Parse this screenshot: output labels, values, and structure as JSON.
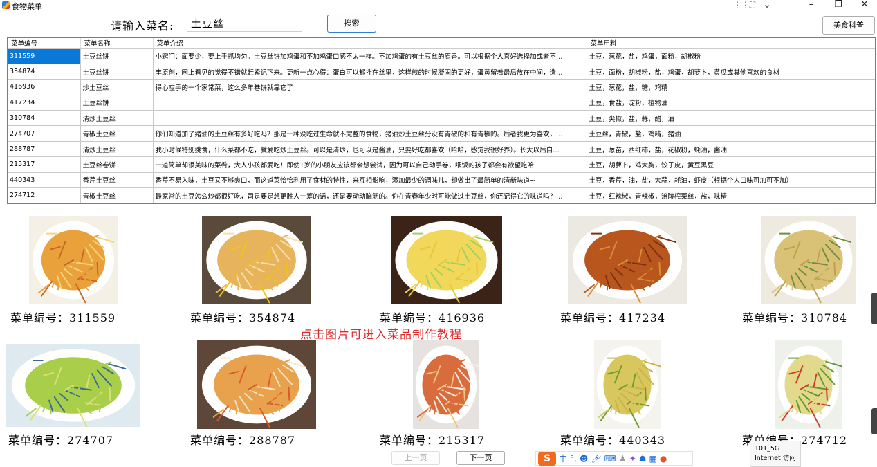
{
  "window": {
    "title": "食物菜单",
    "minimize": "–",
    "maximize": "❐",
    "close": "✕"
  },
  "titlebar_tools": {
    "grip": "⋮⋮",
    "expand": "⛶",
    "chevron": "⌄"
  },
  "search": {
    "label": "请输入菜名:",
    "value": "土豆丝",
    "button": "搜索"
  },
  "cookbook_button": "美食科普",
  "table": {
    "columns": [
      "菜单编号",
      "菜单名称",
      "菜单介绍",
      "菜单用料"
    ],
    "rows": [
      [
        "311559",
        "土豆丝饼",
        "小窍门：面要少，要上手抓均匀。土豆丝饼加鸡蛋和不加鸡蛋口感不太一样。不加鸡蛋的有土豆丝的原香。可以根据个人喜好选择加或者不…",
        "土豆，葱花，盐，鸡蛋，面粉，胡椒粉"
      ],
      [
        "354874",
        "土豆丝饼",
        "丰原创，网上看见的觉得不错就赶紧记下来。更新一点心得：蛋白可以都拌在丝里，这样煎的时候凝固的更好，蛋黄留着最后放在中间，造…",
        "土豆，面粉，胡椒粉，盐，鸡蛋，胡萝卜，黄瓜或其他喜欢的食材"
      ],
      [
        "416936",
        "炒土豆丝",
        "得心应手的一个家常菜，这么多年卷饼就靠它了",
        "土豆，葱花，盐，糖，鸡精"
      ],
      [
        "417234",
        "土豆丝饼",
        "",
        "土豆，食盐，淀粉，植物油"
      ],
      [
        "310784",
        "清炒土豆丝",
        "",
        "土豆，尖椒，盐，蒜，醋，油"
      ],
      [
        "274707",
        "青椒土豆丝",
        "你们知道加了猪油的土豆丝有多好吃吗？那是一种没吃过生命就不完整的食物，猪油炒土豆丝分没有青椒的和有青椒的。后者我更为喜欢，…",
        "土豆丝，青椒，盐，鸡精，猪油"
      ],
      [
        "288787",
        "清炒土豆丝",
        "我小时候特别挑食，什么菜都不吃，就爱吃炒土豆丝。可以是清炒，也可以是酱油，只要好吃都喜欢（哈哈，感觉我很好养）。长大以后自…",
        "土豆，葱苗，西红柿，盐，花椒粉，蚝油，酱油"
      ],
      [
        "215317",
        "土豆丝卷饼",
        "一道简单却很美味的菜肴，大人小孩都爱吃！即使1岁的小朋友应该都会想尝试，因为可以自己动手卷，喂饭的孩子都会有欲望吃哈",
        "土豆，胡萝卜，鸡大胸，饺子皮，黄豆黑豆"
      ],
      [
        "440343",
        "香芹土豆丝",
        "香芹不易入味，土豆又不够爽口，而这道菜恰恰利用了食材的特性，来互相影响，添加最少的调味儿，却做出了最简单的清新味道~",
        "土豆，香芹，油，盐，大蒜，耗油，虾皮（根据个人口味可加可不加）"
      ],
      [
        "274712",
        "青椒土豆丝",
        "最家常的土豆怎么炒都很好吃，司是要是想更胜人一筹的话，还是要动动脑筋的。你在青春年少时可能做过土豆丝，你还记得它的味道吗？…",
        "土豆，红辣椒，青辣椒，涪陵榨菜丝，盐，味精"
      ]
    ]
  },
  "gallery": {
    "caption_prefix": "菜单编号：",
    "hint": "点击图片可进入菜品制作教程",
    "items": [
      {
        "id": "311559",
        "image": "potato-pancake-photo"
      },
      {
        "id": "354874",
        "image": "potato-nest-egg-photo"
      },
      {
        "id": "416936",
        "image": "shredded-potato-photo"
      },
      {
        "id": "417234",
        "image": "crispy-potato-cake-photo"
      },
      {
        "id": "310784",
        "image": "stir-fried-potato-photo"
      },
      {
        "id": "274707",
        "image": "green-pepper-potato-photo"
      },
      {
        "id": "288787",
        "image": "tomato-potato-photo"
      },
      {
        "id": "215317",
        "image": "potato-wrap-platter-photo"
      },
      {
        "id": "440343",
        "image": "celery-potato-photo"
      },
      {
        "id": "274712",
        "image": "chili-potato-photo"
      }
    ]
  },
  "pager": {
    "prev": "上一页",
    "next": "下一页"
  },
  "ime": {
    "logo": "S",
    "mode": "中",
    "punct": "°,",
    "icons": [
      "emoji-icon",
      "mic-icon",
      "keyboard-icon",
      "skin-icon",
      "toolbox-icon",
      "game-icon",
      "grid-icon",
      "user-icon"
    ]
  },
  "tooltip": {
    "line1": "101_5G",
    "line2": "Internet 访问"
  },
  "colors": {
    "selection": "#0a78d7",
    "hint": "#e02a2a",
    "search_border": "#2f7fd6"
  }
}
